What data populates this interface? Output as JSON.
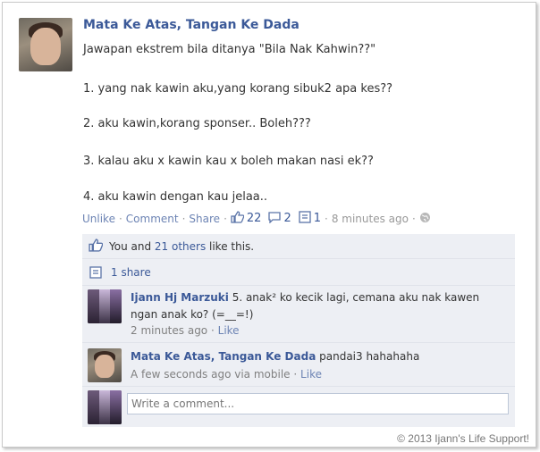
{
  "post": {
    "author": "Mata Ke Atas, Tangan Ke Dada",
    "lines": [
      "Jawapan ekstrem bila ditanya \"Bila Nak Kahwin??\"",
      "1. yang nak kawin aku,yang korang sibuk2 apa kes??",
      "2. aku kawin,korang sponser.. Boleh???",
      "3. kalau aku x kawin kau x boleh makan nasi ek??",
      "4. aku kawin dengan kau jelaa.."
    ]
  },
  "actions": {
    "unlike": "Unlike",
    "comment": "Comment",
    "share": "Share",
    "likes_count": "22",
    "comments_count": "2",
    "shares_count": "1",
    "time": "8 minutes ago",
    "separator": "·"
  },
  "likes": {
    "prefix": "You and ",
    "others_link": "21 others",
    "suffix": " like this."
  },
  "shares": {
    "label": "1 share"
  },
  "comments": [
    {
      "author": "Ijann Hj Marzuki",
      "text_line1": "5. anak² ko kecik lagi, cemana aku nak kawen",
      "text_line2": "ngan anak ko? (=__=!)",
      "time": "2 minutes ago",
      "like": "Like",
      "separator": "·"
    },
    {
      "author": "Mata Ke Atas, Tangan Ke Dada",
      "text": "pandai3 hahahaha",
      "time": "A few seconds ago via mobile",
      "like": "Like",
      "separator": "·"
    }
  ],
  "composer": {
    "placeholder": "Write a comment..."
  },
  "footer": {
    "watermark": "© 2013 Ijann's Life Support!"
  },
  "colors": {
    "link": "#3b5998",
    "panel": "#edeff4",
    "muted": "#999999"
  },
  "icons": [
    "thumbs-up-icon",
    "comment-bubble-icon",
    "share-icon",
    "globe-icon"
  ]
}
